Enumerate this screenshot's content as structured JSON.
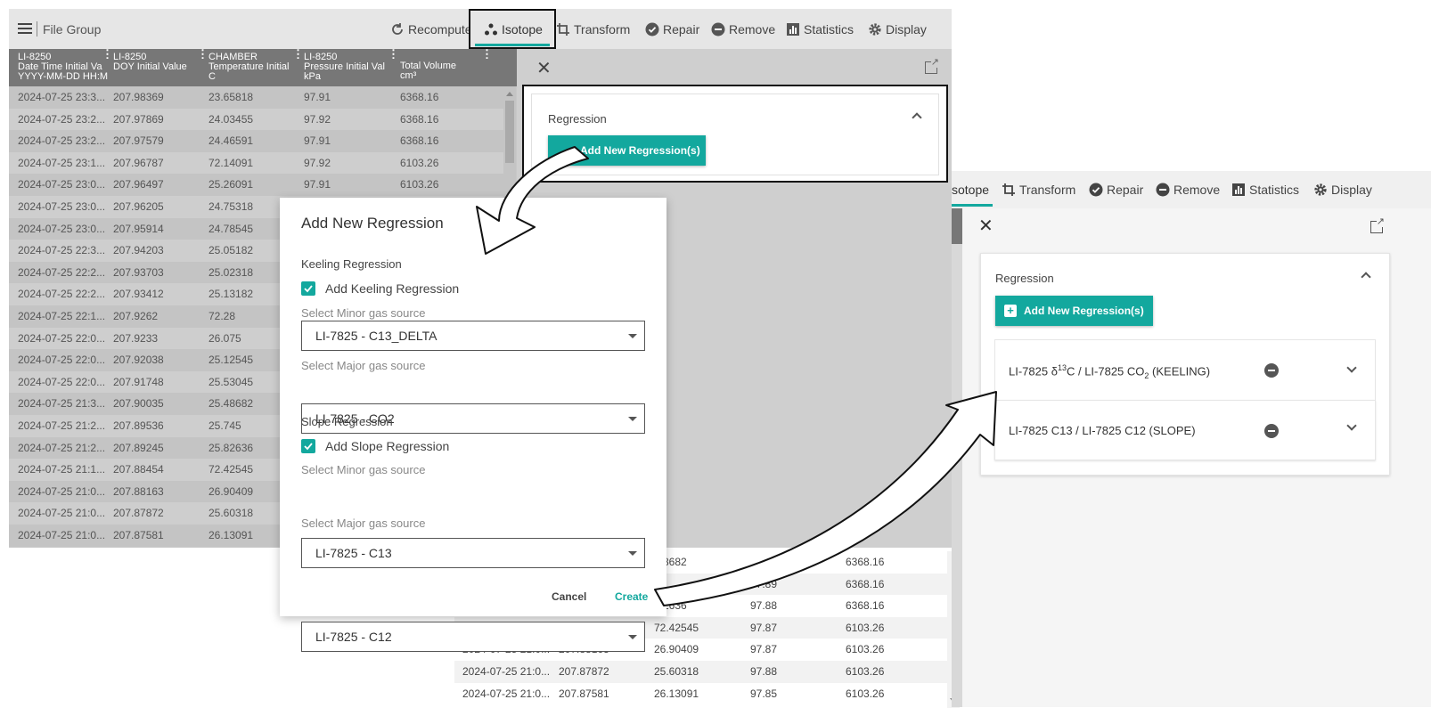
{
  "left": {
    "header": {
      "menu_icon": "menu-icon",
      "title": "File Group"
    },
    "toolbar": [
      {
        "key": "recompute",
        "label": "Recompute",
        "icon": "refresh-icon"
      },
      {
        "key": "isotope",
        "label": "Isotope",
        "icon": "isotope-icon"
      },
      {
        "key": "transform",
        "label": "Transform",
        "icon": "crop-icon"
      },
      {
        "key": "repair",
        "label": "Repair",
        "icon": "check-circle-icon"
      },
      {
        "key": "remove",
        "label": "Remove",
        "icon": "minus-circle-icon"
      },
      {
        "key": "statistics",
        "label": "Statistics",
        "icon": "bar-chart-icon"
      },
      {
        "key": "display",
        "label": "Display",
        "icon": "gear-icon"
      }
    ],
    "columns": [
      {
        "l1": "LI-8250",
        "l2": "Date Time Initial Va",
        "l3": "YYYY-MM-DD HH:M"
      },
      {
        "l1": "LI-8250",
        "l2": "DOY Initial Value",
        "l3": ""
      },
      {
        "l1": "CHAMBER",
        "l2": "Temperature Initial",
        "l3": "C"
      },
      {
        "l1": "LI-8250",
        "l2": "Pressure Initial Val",
        "l3": "kPa"
      },
      {
        "l1": "",
        "l2": "Total Volume",
        "l3": "cm³"
      }
    ],
    "rows": [
      [
        "2024-07-25 23:3...",
        "207.98369",
        "23.65818",
        "97.91",
        "6368.16"
      ],
      [
        "2024-07-25 23:2...",
        "207.97869",
        "24.03455",
        "97.92",
        "6368.16"
      ],
      [
        "2024-07-25 23:2...",
        "207.97579",
        "24.46591",
        "97.91",
        "6368.16"
      ],
      [
        "2024-07-25 23:1...",
        "207.96787",
        "72.14091",
        "97.92",
        "6103.26"
      ],
      [
        "2024-07-25 23:0...",
        "207.96497",
        "25.26091",
        "97.91",
        "6103.26"
      ],
      [
        "2024-07-25 23:0...",
        "207.96205",
        "24.75318",
        "",
        ""
      ],
      [
        "2024-07-25 23:0...",
        "207.95914",
        "24.78545",
        "",
        ""
      ],
      [
        "2024-07-25 22:3...",
        "207.94203",
        "25.05182",
        "",
        ""
      ],
      [
        "2024-07-25 22:2...",
        "207.93703",
        "25.02318",
        "",
        ""
      ],
      [
        "2024-07-25 22:2...",
        "207.93412",
        "25.13182",
        "",
        ""
      ],
      [
        "2024-07-25 22:1...",
        "207.9262",
        "72.28",
        "",
        ""
      ],
      [
        "2024-07-25 22:0...",
        "207.9233",
        "26.075",
        "",
        ""
      ],
      [
        "2024-07-25 22:0...",
        "207.92038",
        "25.12545",
        "",
        ""
      ],
      [
        "2024-07-25 22:0...",
        "207.91748",
        "25.53045",
        "",
        ""
      ],
      [
        "2024-07-25 21:3...",
        "207.90035",
        "25.48682",
        "",
        ""
      ],
      [
        "2024-07-25 21:2...",
        "207.89536",
        "25.745",
        "",
        ""
      ],
      [
        "2024-07-25 21:2...",
        "207.89245",
        "25.82636",
        "",
        ""
      ],
      [
        "2024-07-25 21:1...",
        "207.88454",
        "72.42545",
        "",
        ""
      ],
      [
        "2024-07-25 21:0...",
        "207.88163",
        "26.90409",
        "",
        ""
      ],
      [
        "2024-07-25 21:0...",
        "207.87872",
        "25.60318",
        "",
        ""
      ],
      [
        "2024-07-25 21:0...",
        "207.87581",
        "26.13091",
        "",
        ""
      ]
    ],
    "regression_title": "Regression",
    "add_button": "Add New Regression(s)"
  },
  "lower_rows": [
    [
      "",
      "",
      ".48682",
      "",
      "6368.16"
    ],
    [
      "",
      "",
      "",
      "97.89",
      "6368.16"
    ],
    [
      "",
      "",
      ".82636",
      "97.88",
      "6368.16"
    ],
    [
      "2024-07-25 21:1...",
      "207.88454",
      "72.42545",
      "97.87",
      "6103.26"
    ],
    [
      "2024-07-25 21:0...",
      "207.88163",
      "26.90409",
      "97.87",
      "6103.26"
    ],
    [
      "2024-07-25 21:0...",
      "207.87872",
      "25.60318",
      "97.88",
      "6103.26"
    ],
    [
      "2024-07-25 21:0...",
      "207.87581",
      "26.13091",
      "97.85",
      "6103.26"
    ]
  ],
  "dialog": {
    "title": "Add New Regression",
    "keeling_section": "Keeling Regression",
    "keeling_checkbox": "Add Keeling Regression",
    "minor_label": "Select Minor gas source",
    "major_label": "Select Major gas source",
    "keeling_minor": "LI-7825 - C13_DELTA",
    "keeling_major": "LI-7825 - CO2",
    "slope_section": "Slope Regression",
    "slope_checkbox": "Add Slope Regression",
    "slope_minor": "LI-7825 - C13",
    "slope_major": "LI-7825 - C12",
    "cancel": "Cancel",
    "create": "Create"
  },
  "right": {
    "toolbar": [
      {
        "key": "isotope",
        "label": "sotope",
        "icon": ""
      },
      {
        "key": "transform",
        "label": "Transform",
        "icon": "crop-icon"
      },
      {
        "key": "repair",
        "label": "Repair",
        "icon": "check-circle-icon"
      },
      {
        "key": "remove",
        "label": "Remove",
        "icon": "minus-circle-icon"
      },
      {
        "key": "statistics",
        "label": "Statistics",
        "icon": "bar-chart-icon"
      },
      {
        "key": "display",
        "label": "Display",
        "icon": "gear-icon"
      }
    ],
    "regression_title": "Regression",
    "add_button": "Add New Regression(s)",
    "items": [
      {
        "a": "LI-7825 δ",
        "sup": "13",
        "b": "C / LI-7825 CO",
        "sub": "2",
        "c": " (KEELING)"
      },
      {
        "a": "LI-7825 C13 / LI-7825 C12 (SLOPE)",
        "sup": "",
        "b": "",
        "sub": "",
        "c": ""
      }
    ]
  },
  "colors": {
    "accent": "#13a89e",
    "header_gray": "#777777",
    "overlay_gray": "#cccccc"
  }
}
